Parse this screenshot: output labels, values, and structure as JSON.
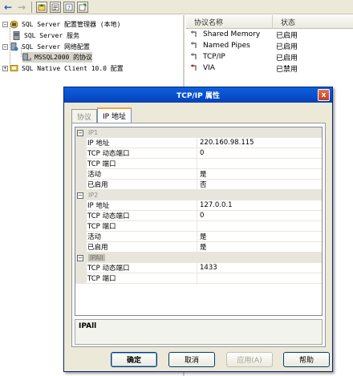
{
  "toolbar": {
    "back_icon": "←",
    "forward_icon": "→",
    "buttons": [
      "up-icon",
      "properties-icon",
      "help-icon",
      "export-icon"
    ]
  },
  "tree": {
    "items": [
      {
        "label": "SQL Server 配置管理器 (本地)",
        "icon": "server-manager-icon"
      },
      {
        "label": "SQL Server 服务",
        "icon": "services-icon"
      },
      {
        "label": "SQL Server 网络配置",
        "icon": "network-icon"
      },
      {
        "label": "MSSQL2000 的协议",
        "icon": "protocols-icon"
      },
      {
        "label": "SQL Native Client 10.0 配置",
        "icon": "client-config-icon"
      }
    ]
  },
  "list": {
    "columns": [
      "协议名称",
      "状态"
    ],
    "rows": [
      {
        "name": "Shared Memory",
        "state": "已启用"
      },
      {
        "name": "Named Pipes",
        "state": "已启用"
      },
      {
        "name": "TCP/IP",
        "state": "已启用"
      },
      {
        "name": "VIA",
        "state": "已禁用"
      }
    ]
  },
  "dialog": {
    "title": "TCP/IP 属性",
    "close_icon": "x",
    "tabs": [
      "协议",
      "IP 地址"
    ],
    "active_tab": 1,
    "groups": [
      {
        "name": "IP1",
        "rows": [
          {
            "key": "IP 地址",
            "value": "220.160.98.115"
          },
          {
            "key": "TCP 动态端口",
            "value": "0"
          },
          {
            "key": "TCP 端口",
            "value": ""
          },
          {
            "key": "活动",
            "value": "是"
          },
          {
            "key": "已启用",
            "value": "否"
          }
        ]
      },
      {
        "name": "IP2",
        "rows": [
          {
            "key": "IP 地址",
            "value": "127.0.0.1"
          },
          {
            "key": "TCP 动态端口",
            "value": "0"
          },
          {
            "key": "TCP 端口",
            "value": ""
          },
          {
            "key": "活动",
            "value": "是"
          },
          {
            "key": "已启用",
            "value": "是"
          }
        ]
      },
      {
        "name": "IPAll",
        "rows": [
          {
            "key": "TCP 动态端口",
            "value": "1433"
          },
          {
            "key": "TCP 端口",
            "value": ""
          }
        ]
      }
    ],
    "description": "IPAll",
    "buttons": {
      "ok": "确定",
      "cancel": "取消",
      "apply": "应用(A)",
      "help": "帮助"
    }
  },
  "colors": {
    "title_bar": "#0b61e0",
    "dialog_bg": "#ece9d8",
    "tab_highlight": "#f1a54a"
  }
}
